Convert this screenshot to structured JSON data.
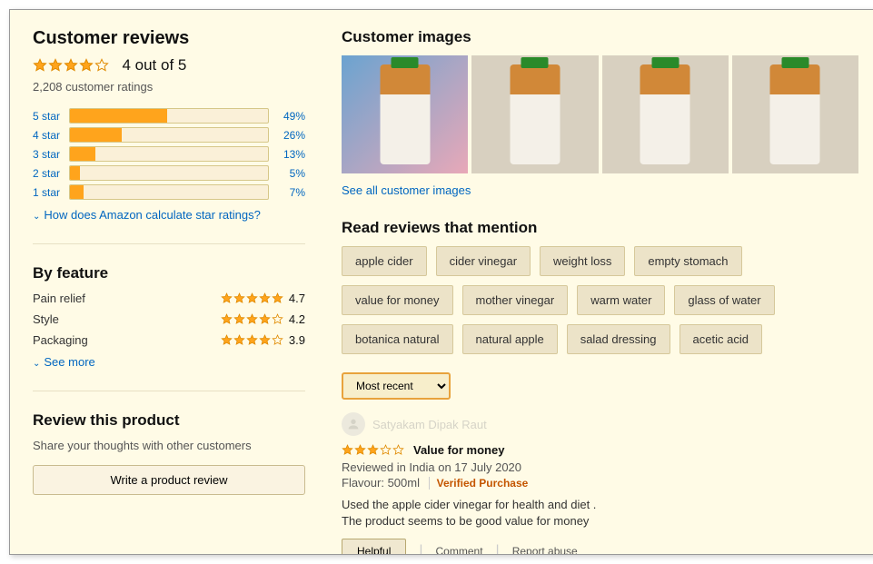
{
  "left": {
    "heading": "Customer reviews",
    "summary": "4 out of 5",
    "overall_stars": 4,
    "ratings_count": "2,208 customer ratings",
    "histogram": [
      {
        "label": "5 star",
        "pct": 49
      },
      {
        "label": "4 star",
        "pct": 26
      },
      {
        "label": "3 star",
        "pct": 13
      },
      {
        "label": "2 star",
        "pct": 5
      },
      {
        "label": "1 star",
        "pct": 7
      }
    ],
    "calc_link": "How does Amazon calculate star ratings?",
    "by_feature_heading": "By feature",
    "features": [
      {
        "name": "Pain relief",
        "stars": 5,
        "score": "4.7"
      },
      {
        "name": "Style",
        "stars": 4,
        "score": "4.2"
      },
      {
        "name": "Packaging",
        "stars": 4,
        "score": "3.9"
      }
    ],
    "see_more": "See more",
    "review_this_heading": "Review this product",
    "review_prompt": "Share your thoughts with other customers",
    "write_btn": "Write a product review"
  },
  "right": {
    "images_heading": "Customer images",
    "see_all_images": "See all customer images",
    "mentions_heading": "Read reviews that mention",
    "tags": [
      "apple cider",
      "cider vinegar",
      "weight loss",
      "empty stomach",
      "value for money",
      "mother vinegar",
      "warm water",
      "glass of water",
      "botanica natural",
      "natural apple",
      "salad dressing",
      "acetic acid"
    ],
    "sort_value": "Most recent",
    "reviewer_name": "Satyakam Dipak Raut",
    "review_stars": 3,
    "review_title": "Value for money",
    "review_meta": "Reviewed in India on 17 July 2020",
    "flavour": "Flavour: 500ml",
    "verified": "Verified Purchase",
    "review_body_1": "Used the apple cider vinegar for health and diet .",
    "review_body_2": "The product seems to be good value for money",
    "helpful": "Helpful",
    "comment": "Comment",
    "report": "Report abuse"
  }
}
